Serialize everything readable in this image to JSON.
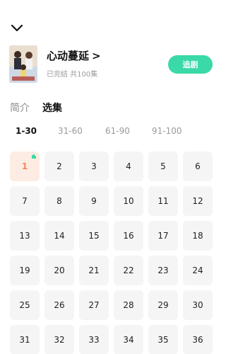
{
  "show": {
    "title": "心动蔓延",
    "title_chevron": ">",
    "meta": "已完结 共100集",
    "follow_label": "追剧"
  },
  "tabs": [
    {
      "label": "简介",
      "active": false
    },
    {
      "label": "选集",
      "active": true
    }
  ],
  "ranges": [
    {
      "label": "1-30",
      "active": true
    },
    {
      "label": "31-60",
      "active": false
    },
    {
      "label": "61-90",
      "active": false
    },
    {
      "label": "91-100",
      "active": false
    }
  ],
  "episodes": [
    "1",
    "2",
    "3",
    "4",
    "5",
    "6",
    "7",
    "8",
    "9",
    "10",
    "11",
    "12",
    "13",
    "14",
    "15",
    "16",
    "17",
    "18",
    "19",
    "20",
    "21",
    "22",
    "23",
    "24",
    "25",
    "26",
    "27",
    "28",
    "29",
    "30",
    "31",
    "32",
    "33",
    "34",
    "35",
    "36"
  ],
  "current_episode": "1",
  "colors": {
    "accent": "#3ad9a7",
    "current_episode_text": "#f08a57",
    "current_episode_bg": "#fdece3",
    "playing_indicator": "#3ad9a7"
  },
  "icons": {
    "collapse": "chevron-down-icon",
    "playing": "playing-bars-icon"
  }
}
